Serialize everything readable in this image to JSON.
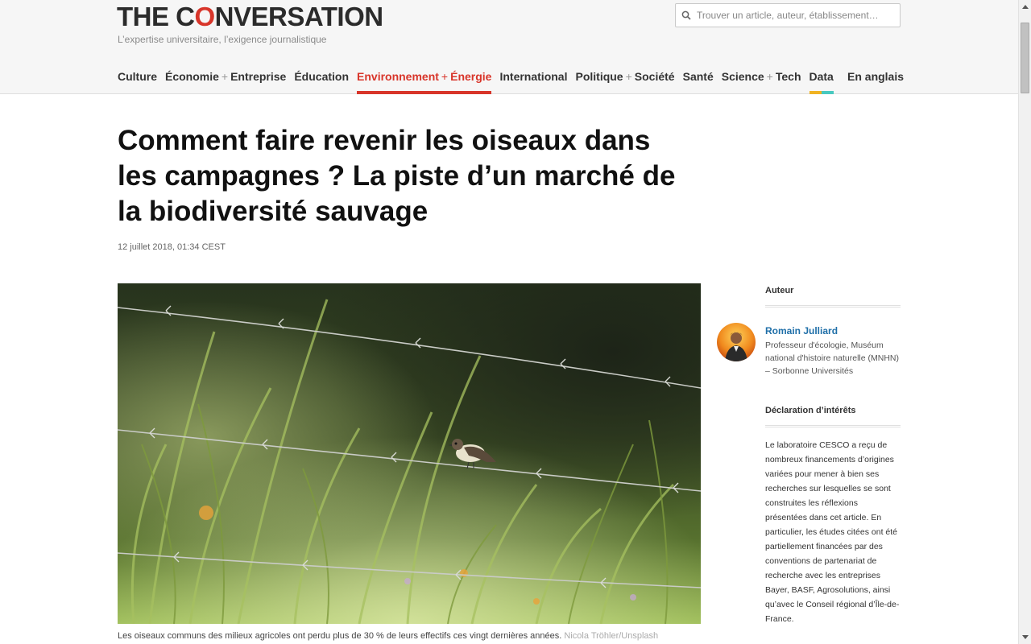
{
  "header": {
    "logo_part1": "THE C",
    "logo_part2": "O",
    "logo_part3": "NVERSATION",
    "tagline": "L’expertise universitaire, l’exigence journalistique",
    "search_placeholder": "Trouver un article, auteur, établissement…",
    "search_icon": "search-icon"
  },
  "nav": {
    "items": [
      {
        "label": "Culture"
      },
      {
        "label_a": "Économie",
        "plus": "+",
        "label_b": "Entreprise"
      },
      {
        "label": "Éducation"
      },
      {
        "label_a": "Environnement",
        "plus": "+",
        "label_b": "Énergie"
      },
      {
        "label": "International"
      },
      {
        "label_a": "Politique",
        "plus": "+",
        "label_b": "Société"
      },
      {
        "label": "Santé"
      },
      {
        "label_a": "Science",
        "plus": "+",
        "label_b": "Tech"
      },
      {
        "label": "Data"
      }
    ],
    "active": "Environnement + Énergie",
    "english": "En anglais"
  },
  "article": {
    "title": "Comment faire revenir les oiseaux dans les campagnes ? La piste d’un marché de la biodiversité sauvage",
    "date": "12 juillet 2018, 01:34 CEST",
    "caption": "Les oiseaux communs des milieux agricoles ont perdu plus de 30 % de leurs effectifs ces vingt dernières années.",
    "credit": "Nicola Tröhler/Unsplash"
  },
  "sidebar": {
    "author_heading": "Auteur",
    "author_name": "Romain Julliard",
    "author_bio": "Professeur d'écologie, Muséum national d'histoire naturelle (MNHN) – Sorbonne Universités",
    "disclosure_heading": "Déclaration d’intérêts",
    "disclosure_text": "Le laboratoire CESCO a reçu de nombreux financements d’origines variées pour mener à bien ses recherches sur lesquelles se sont construites les réflexions présentées dans cet article. En particulier, les études citées ont été partiellement financées par des conventions de partenariat de recherche avec les entreprises Bayer, BASF, Agrosolutions, ainsi qu’avec le Conseil régional d’Île-de-France."
  },
  "colors": {
    "brand_red": "#d8352a",
    "link_blue": "#1f6fa8",
    "data_yellow": "#f0b323",
    "data_teal": "#48c9c0"
  }
}
